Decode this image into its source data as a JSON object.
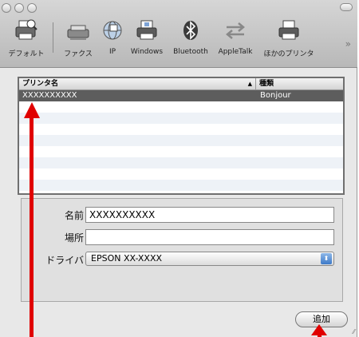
{
  "toolbar": {
    "items": [
      {
        "label": "デフォルト",
        "icon": "default-printer-icon"
      },
      {
        "label": "ファクス",
        "icon": "fax-icon"
      },
      {
        "label": "IP",
        "icon": "globe-icon"
      },
      {
        "label": "Windows",
        "icon": "windows-printer-icon"
      },
      {
        "label": "Bluetooth",
        "icon": "bluetooth-icon"
      },
      {
        "label": "AppleTalk",
        "icon": "appletalk-icon"
      },
      {
        "label": "ほかのプリンタ",
        "icon": "printer-icon"
      }
    ],
    "overflow": "»"
  },
  "printer_list": {
    "columns": {
      "name": "プリンタ名",
      "kind": "種類",
      "sort": "▲"
    },
    "rows": [
      {
        "name": "XXXXXXXXXX",
        "kind": "Bonjour",
        "selected": true
      }
    ]
  },
  "form": {
    "name_label": "名前：",
    "name_value": "XXXXXXXXXX",
    "location_label": "場所：",
    "location_value": "",
    "driver_label": "ドライバ：",
    "driver_value": "EPSON XX-XXXX",
    "driver_arrow": "⬍"
  },
  "add_button": "追加",
  "colors": {
    "annotation": "#e00000",
    "selection": "#5d5d5d"
  }
}
